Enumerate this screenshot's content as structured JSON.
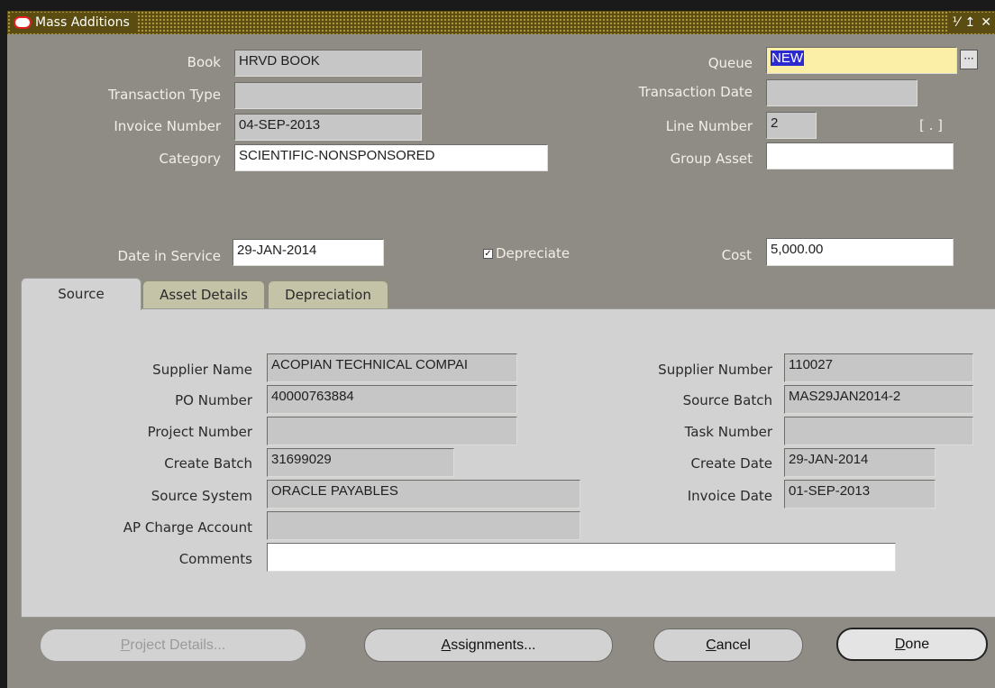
{
  "window": {
    "title": "Mass Additions",
    "controls": [
      "⅟",
      "↥",
      "✕"
    ]
  },
  "header": {
    "book": {
      "label": "Book",
      "value": "HRVD BOOK"
    },
    "transaction_type": {
      "label": "Transaction Type",
      "value": ""
    },
    "invoice_number": {
      "label": "Invoice Number",
      "value": "04-SEP-2013"
    },
    "category": {
      "label": "Category",
      "value": "SCIENTIFIC-NONSPONSORED"
    },
    "queue": {
      "label": "Queue",
      "value": "NEW"
    },
    "transaction_date": {
      "label": "Transaction Date",
      "value": ""
    },
    "line_number": {
      "label": "Line Number",
      "value": "2"
    },
    "flex_bracket": "[ . ]",
    "group_asset": {
      "label": "Group Asset",
      "value": ""
    },
    "date_in_service": {
      "label": "Date in Service",
      "value": "29-JAN-2014"
    },
    "depreciate": {
      "label": "Depreciate",
      "checked": true
    },
    "cost": {
      "label": "Cost",
      "value": "5,000.00"
    }
  },
  "tabs": [
    {
      "label": "Source",
      "active": true
    },
    {
      "label": "Asset Details",
      "active": false
    },
    {
      "label": "Depreciation",
      "active": false
    }
  ],
  "source": {
    "supplier_name": {
      "label": "Supplier Name",
      "value": "ACOPIAN TECHNICAL COMPAI"
    },
    "po_number": {
      "label": "PO Number",
      "value": "40000763884"
    },
    "project_number": {
      "label": "Project Number",
      "value": ""
    },
    "create_batch": {
      "label": "Create Batch",
      "value": "31699029"
    },
    "source_system": {
      "label": "Source System",
      "value": "ORACLE PAYABLES"
    },
    "ap_charge_account": {
      "label": "AP Charge Account",
      "value": ""
    },
    "comments": {
      "label": "Comments",
      "value": ""
    },
    "supplier_number": {
      "label": "Supplier Number",
      "value": "110027"
    },
    "source_batch": {
      "label": "Source Batch",
      "value": "MAS29JAN2014-2"
    },
    "task_number": {
      "label": "Task Number",
      "value": ""
    },
    "create_date": {
      "label": "Create Date",
      "value": "29-JAN-2014"
    },
    "invoice_date": {
      "label": "Invoice Date",
      "value": "01-SEP-2013"
    }
  },
  "buttons": {
    "project_details": {
      "accel": "P",
      "rest": "roject Details...",
      "enabled": false
    },
    "assignments": {
      "accel": "A",
      "rest": "ssignments..."
    },
    "cancel": {
      "accel": "C",
      "rest": "ancel"
    },
    "done": {
      "accel": "D",
      "rest": "one"
    }
  },
  "colors": {
    "title_bar": "#5b4d12",
    "window_bg": "#8e8c85",
    "panel_bg": "#d2d2d2",
    "queue_field": "#fbeea6"
  }
}
